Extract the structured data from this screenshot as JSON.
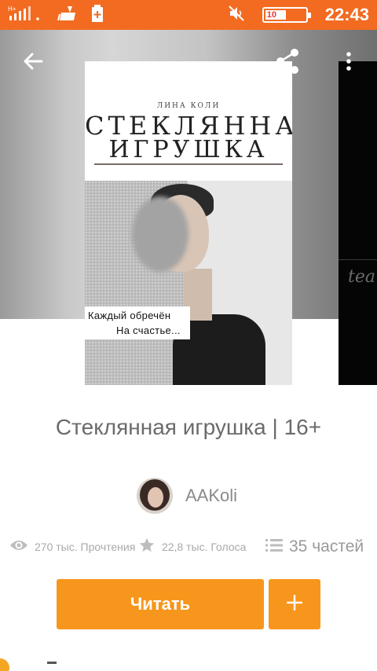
{
  "status_bar": {
    "signal_icon": "cellular-signal-icon",
    "broom_icon": "cleaner-icon",
    "notification_icon": "battery-plus-icon",
    "mute_icon": "volume-muted-icon",
    "battery_level": "10",
    "time": "22:43"
  },
  "header": {
    "back_icon": "arrow-left-icon",
    "share_icon": "share-icon",
    "more_icon": "more-vertical-icon"
  },
  "cover": {
    "author": "ЛИНА КОЛИ",
    "title_line1": "СТЕКЛЯННАЯ",
    "title_line2": "ИГРУШКА",
    "caption_line1": "Каждый обречён",
    "caption_line2": "На счастье..."
  },
  "side_cover": {
    "script_text": "tea"
  },
  "story": {
    "title": "Стеклянная игрушка | 16+",
    "author": "AAKoli"
  },
  "stats": {
    "reads": "270 тыс. Прочтения",
    "votes": "22,8 тыс. Голоса",
    "parts": "35 частей"
  },
  "actions": {
    "read_label": "Читать",
    "add_label": "+"
  },
  "colors": {
    "status_bar": "#f26b21",
    "accent": "#f7961d",
    "text_muted": "#a9a9a9"
  }
}
